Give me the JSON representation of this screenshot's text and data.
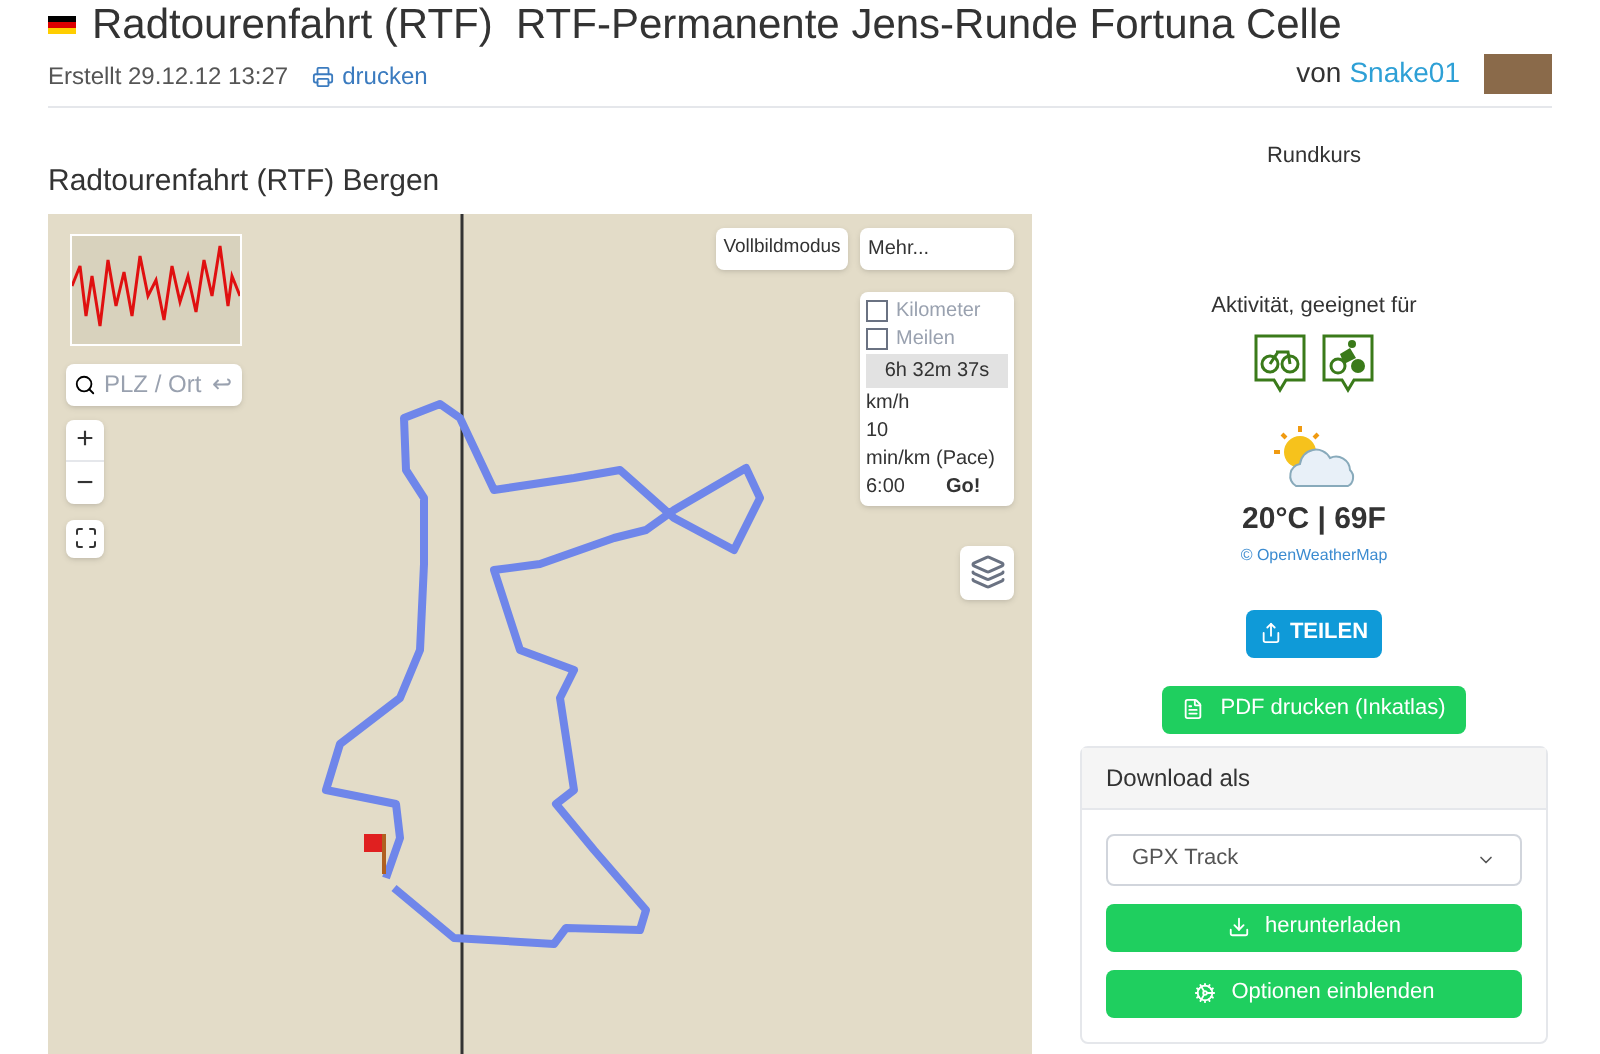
{
  "header": {
    "title": "Radtourenfahrt (RTF)  RTF-Permanente Jens-Runde Fortuna Celle",
    "created": "Erstellt 29.12.12 13:27",
    "print_link": "drucken",
    "author_prefix": "von",
    "author": "Snake01"
  },
  "route_type": "Rundkurs",
  "map": {
    "title": "Radtourenfahrt (RTF) Bergen",
    "search": {
      "placeholder": "PLZ / Ort",
      "enter_glyph": "↩"
    },
    "zoom_in": "+",
    "zoom_out": "−",
    "buttons": [
      "Vollbildmodus",
      "Mehr..."
    ],
    "units": [
      {
        "label": "Kilometer",
        "checked": false
      },
      {
        "label": "Meilen",
        "checked": false
      }
    ],
    "duration": "6h 32m 37s",
    "speed_label": "km/h",
    "speed_value": "10",
    "pace_label": "min/km (Pace)",
    "pace_value": "6:00",
    "go": "Go!"
  },
  "sidebar": {
    "activity_label": "Aktivität, geeignet für",
    "weather": {
      "temperature": "20°C | 69F",
      "credit": "© OpenWeatherMap"
    },
    "share": "TEILEN",
    "pdf": "PDF drucken (Inkatlas)",
    "download": {
      "title": "Download als",
      "format": "GPX Track",
      "buttons": [
        {
          "label": "herunterladen",
          "kind": "download"
        },
        {
          "label": "Optionen einblenden",
          "kind": "options"
        }
      ]
    }
  }
}
